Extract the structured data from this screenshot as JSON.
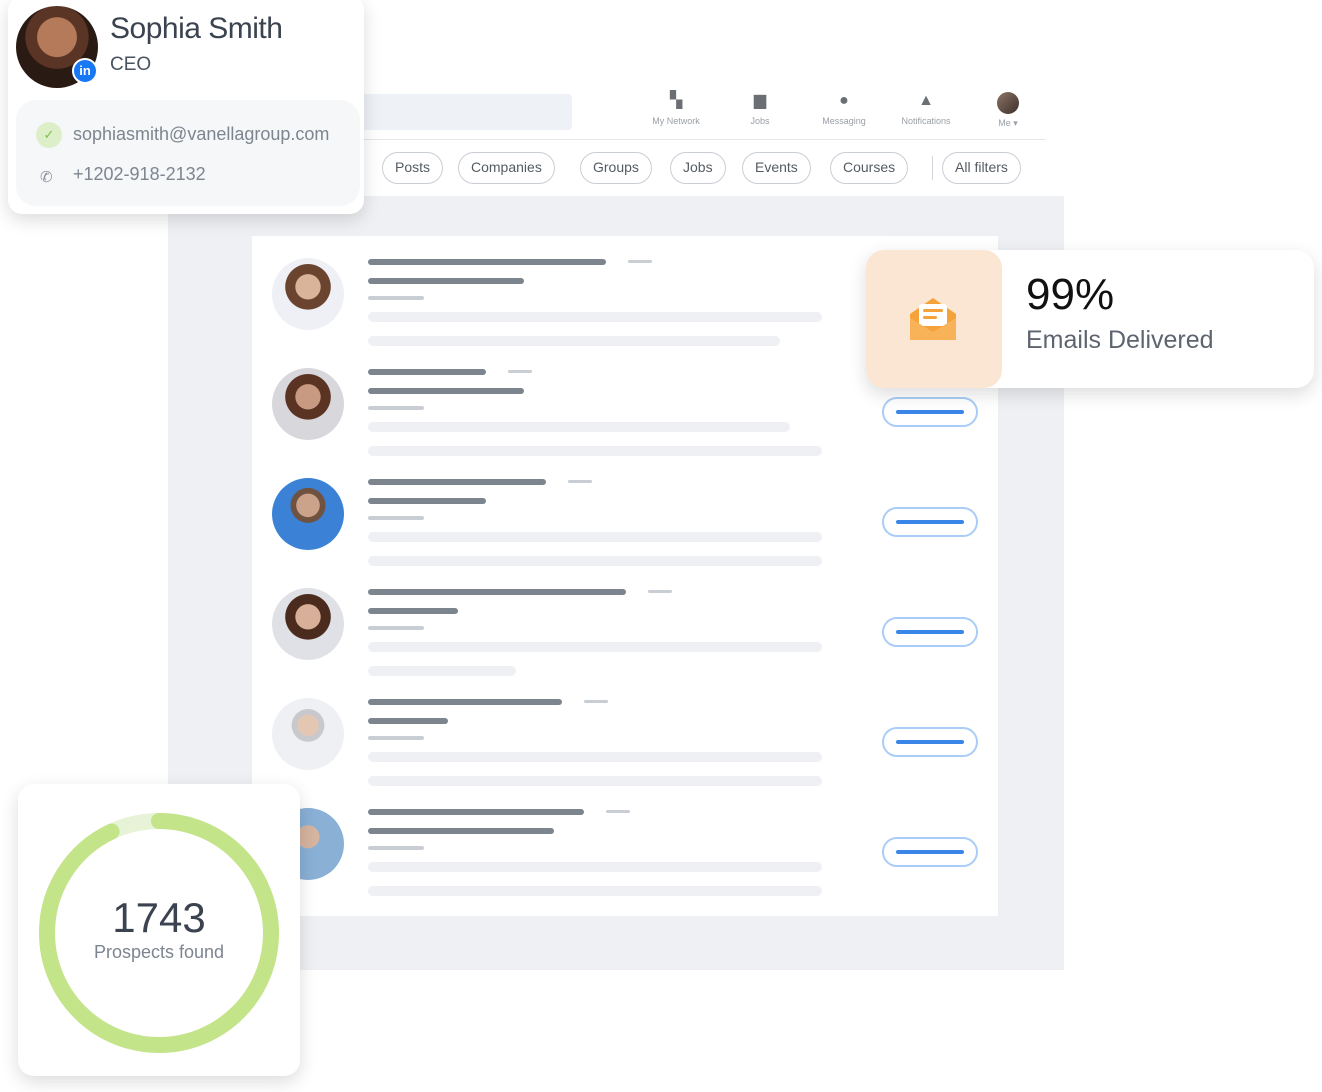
{
  "profile": {
    "name": "Sophia Smith",
    "role": "CEO",
    "badge": "in",
    "email": "sophiasmith@vanellagroup.com",
    "phone": "+1202-918-2132"
  },
  "topnav": {
    "items": [
      {
        "label": "My Network",
        "icon": "network-icon"
      },
      {
        "label": "Jobs",
        "icon": "briefcase-icon"
      },
      {
        "label": "Messaging",
        "icon": "chat-icon"
      },
      {
        "label": "Notifications",
        "icon": "bell-icon"
      },
      {
        "label": "Me ▾",
        "icon": "avatar"
      }
    ]
  },
  "filters": [
    "Posts",
    "Companies",
    "Groups",
    "Jobs",
    "Events",
    "Courses",
    "All filters"
  ],
  "stats": {
    "emails_value": "99%",
    "emails_label": "Emails Delivered",
    "prospects_value": "1743",
    "prospects_label": "Prospects found",
    "prospects_progress": 0.93
  },
  "colors": {
    "accent_blue": "#3a86e8",
    "linkedin": "#1877f2",
    "ring_green": "#c4e48a",
    "ring_track": "#e6f3d6",
    "email_orange": "#f6a23a"
  }
}
